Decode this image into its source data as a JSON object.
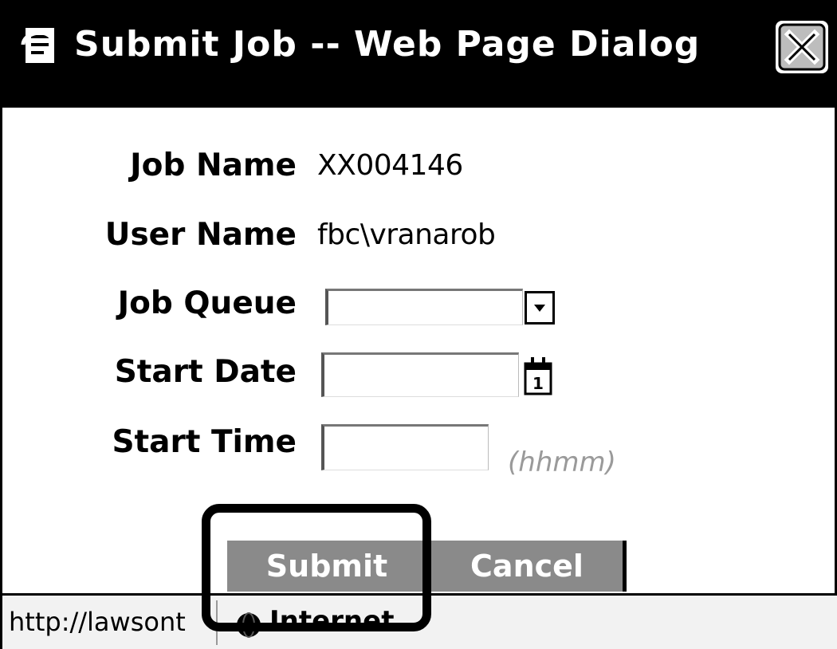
{
  "window": {
    "title": "Submit Job -- Web Page Dialog"
  },
  "form": {
    "job_name": {
      "label": "Job Name",
      "value": "XX004146"
    },
    "user_name": {
      "label": "User Name",
      "value": "fbc\\vranarob"
    },
    "job_queue": {
      "label": "Job Queue",
      "value": ""
    },
    "start_date": {
      "label": "Start Date",
      "value": ""
    },
    "start_time": {
      "label": "Start Time",
      "value": "",
      "hint": "(hhmm)"
    }
  },
  "buttons": {
    "submit_label": "Submit",
    "cancel_label": "Cancel"
  },
  "statusbar": {
    "url": "http://lawsont",
    "zone": "Internet"
  },
  "colors": {
    "titlebar": "#000000",
    "button_bg": "#8a8a8a",
    "button_text": "#ffffff",
    "hint_text": "#9a9a9a"
  },
  "icons": {
    "title": "ie-page-icon",
    "close": "close-icon",
    "dropdown": "chevron-down-icon",
    "calendar": "calendar-icon",
    "zone": "globe-icon"
  }
}
